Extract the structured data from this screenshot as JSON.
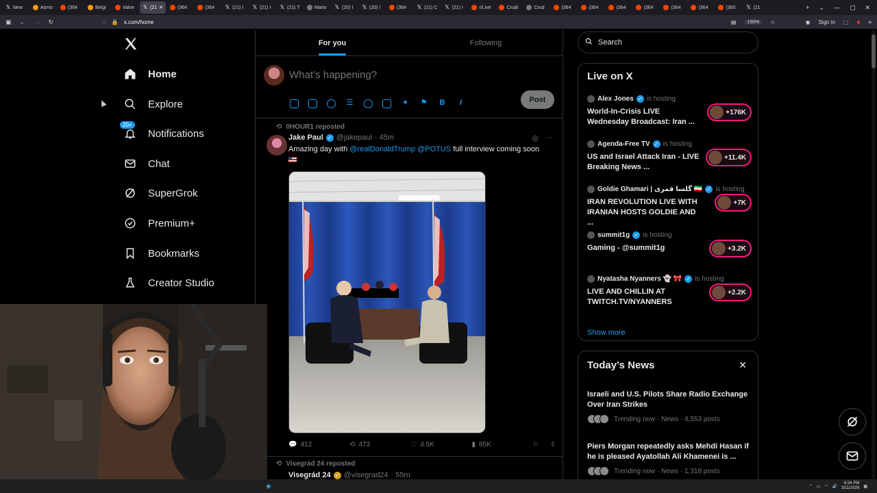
{
  "browser": {
    "tabs": [
      {
        "label": "New",
        "fav": "x"
      },
      {
        "label": "Asmo",
        "fav": "o"
      },
      {
        "label": "(364",
        "fav": "r"
      },
      {
        "label": "Belgi",
        "fav": "o"
      },
      {
        "label": "Valve",
        "fav": "r"
      },
      {
        "label": "(21",
        "fav": "x",
        "active": true
      },
      {
        "label": "(364",
        "fav": "r"
      },
      {
        "label": "(364",
        "fav": "r"
      },
      {
        "label": "(21) I",
        "fav": "x"
      },
      {
        "label": "(21) I",
        "fav": "x"
      },
      {
        "label": "(21) T",
        "fav": "x"
      },
      {
        "label": "Mario",
        "fav": "g"
      },
      {
        "label": "(20) I",
        "fav": "x"
      },
      {
        "label": "(20) I",
        "fav": "x"
      },
      {
        "label": "(364",
        "fav": "r"
      },
      {
        "label": "(21) C",
        "fav": "x"
      },
      {
        "label": "(21) I",
        "fav": "x"
      },
      {
        "label": "r/Live",
        "fav": "r"
      },
      {
        "label": "Crudi",
        "fav": "r"
      },
      {
        "label": "Crud",
        "fav": "g"
      },
      {
        "label": "(364",
        "fav": "r"
      },
      {
        "label": "(364",
        "fav": "r"
      },
      {
        "label": "(364",
        "fav": "r"
      },
      {
        "label": "(364",
        "fav": "r"
      },
      {
        "label": "(364",
        "fav": "r"
      },
      {
        "label": "(364",
        "fav": "r"
      },
      {
        "label": "(360",
        "fav": "r"
      },
      {
        "label": "(21",
        "fav": "x"
      }
    ],
    "url": "x.com/home",
    "zoom": "150%",
    "sign_in": "Sign in"
  },
  "nav": {
    "home": "Home",
    "explore": "Explore",
    "notifications": "Notifications",
    "notif_badge": "20+",
    "chat": "Chat",
    "supergrok": "SuperGrok",
    "premium": "Premium+",
    "bookmarks": "Bookmarks",
    "creator_studio": "Creator Studio"
  },
  "feed": {
    "tab_for_you": "For you",
    "tab_following": "Following",
    "composer_placeholder": "What’s happening?",
    "post_button": "Post",
    "tweet1": {
      "repost_by": "0HOUR1 reposted",
      "name": "Jake Paul",
      "handle": "@jakepaul",
      "time": "· 45m",
      "text_pre": "Amazing day with ",
      "mention1": "@realDonaldTrump",
      "mention2": "@POTUS",
      "text_post": " full interview coming soon",
      "replies": "412",
      "reposts": "473",
      "likes": "4.5K",
      "views": "85K"
    },
    "tweet2": {
      "repost_by": "Visegrád 24 reposted",
      "name": "Visegrád 24",
      "handle": "@visegrad24",
      "time": "· 55m"
    }
  },
  "sidebar": {
    "search_placeholder": "Search",
    "live_title": "Live on X",
    "live": [
      {
        "host": "Alex Jones",
        "status": "is hosting",
        "title": "World-In-Crisis LIVE Wednesday Broadcast: Iran ...",
        "count": "+176K"
      },
      {
        "host": "Agenda-Free TV",
        "status": "is hosting",
        "title": "US and Israel Attack Iran - LIVE Breaking News ...",
        "count": "+11.4K"
      },
      {
        "host": "Goldie Ghamari | گلسا قمری 🇮🇷",
        "status": "is hosting",
        "title": "IRAN REVOLUTION LIVE WITH IRANIAN HOSTS GOLDIE AND ...",
        "count": "+7K"
      },
      {
        "host": "summit1g",
        "status": "is hosting",
        "title": "Gaming - @summit1g",
        "count": "+3.2K"
      },
      {
        "host": "Nyatasha Nyanners 👻 🎀",
        "status": "is hosting",
        "title": "LIVE AND CHILLIN AT TWITCH.TV/NYANNERS",
        "count": "+2.2K"
      }
    ],
    "show_more": "Show more",
    "news_title": "Today’s News",
    "news": [
      {
        "title": "Israeli and U.S. Pilots Share Radio Exchange Over Iran Strikes",
        "meta": "Trending now · News · 4,553 posts"
      },
      {
        "title": "Piers Morgan repeatedly asks Mehdi Hasan if he is pleased Ayatollah Ali Khamenei is ...",
        "meta": "Trending now · News · 1,318 posts"
      }
    ]
  },
  "taskbar": {
    "time": "6:34 PM",
    "date": "3/11/2026"
  },
  "colors": {
    "accent": "#1d9bf0",
    "live_border": "#f91880",
    "background": "#000000"
  }
}
